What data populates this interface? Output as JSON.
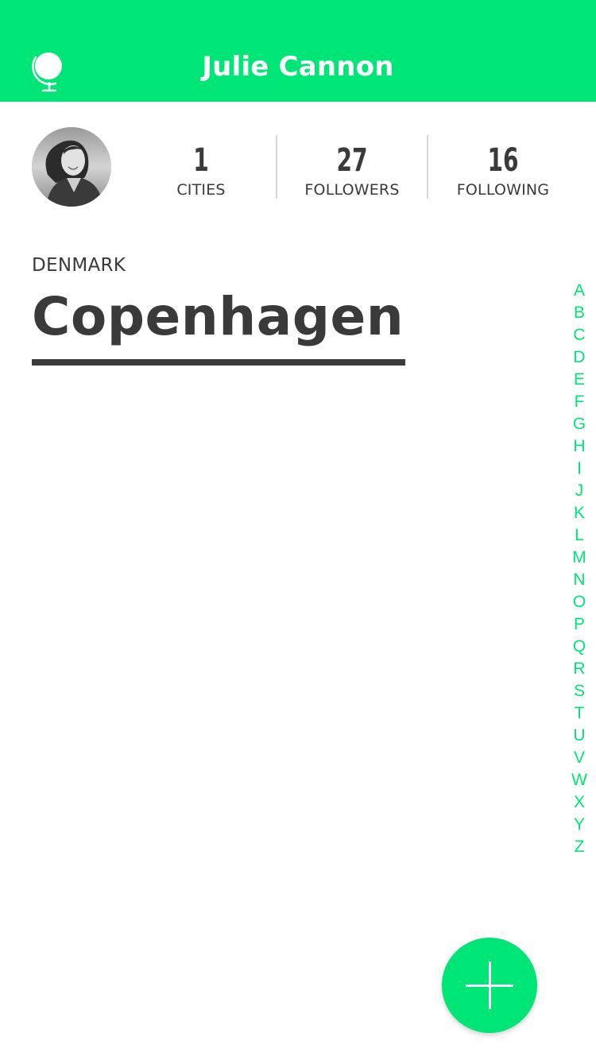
{
  "header": {
    "title": "Julie Cannon",
    "icon": "globe-icon",
    "background_color": "#00e676"
  },
  "profile": {
    "avatar": "avatar-photo",
    "stats": [
      {
        "value": "1",
        "label": "CITIES"
      },
      {
        "value": "27",
        "label": "FOLLOWERS"
      },
      {
        "value": "16",
        "label": "FOLLOWING"
      }
    ]
  },
  "location": {
    "country": "DENMARK",
    "city": "Copenhagen"
  },
  "alphabet_index": [
    "A",
    "B",
    "C",
    "D",
    "E",
    "F",
    "G",
    "H",
    "I",
    "J",
    "K",
    "L",
    "M",
    "N",
    "O",
    "P",
    "Q",
    "R",
    "S",
    "T",
    "U",
    "V",
    "W",
    "X",
    "Y",
    "Z"
  ],
  "fab": {
    "icon": "plus-icon",
    "color": "#00e676"
  },
  "colors": {
    "accent": "#00e676",
    "text": "#3a3a3a"
  }
}
